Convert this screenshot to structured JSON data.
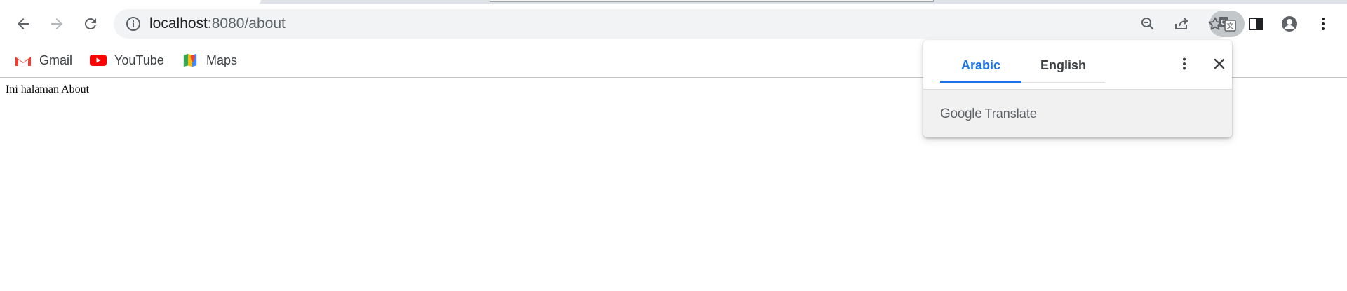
{
  "browser": {
    "url_host": "localhost",
    "url_path": ":8080/about",
    "bookmarks": [
      {
        "label": "Gmail",
        "icon": "gmail-icon"
      },
      {
        "label": "YouTube",
        "icon": "youtube-icon"
      },
      {
        "label": "Maps",
        "icon": "maps-icon"
      }
    ]
  },
  "page": {
    "body_text": "Ini halaman About"
  },
  "translate_popup": {
    "tabs": [
      {
        "label": "Arabic",
        "active": true
      },
      {
        "label": "English",
        "active": false
      }
    ],
    "brand_google": "Google",
    "brand_translate": "Translate"
  },
  "colors": {
    "accent": "#1a73e8",
    "omnibox_bg": "#f1f3f4",
    "icon": "#5f6368"
  }
}
